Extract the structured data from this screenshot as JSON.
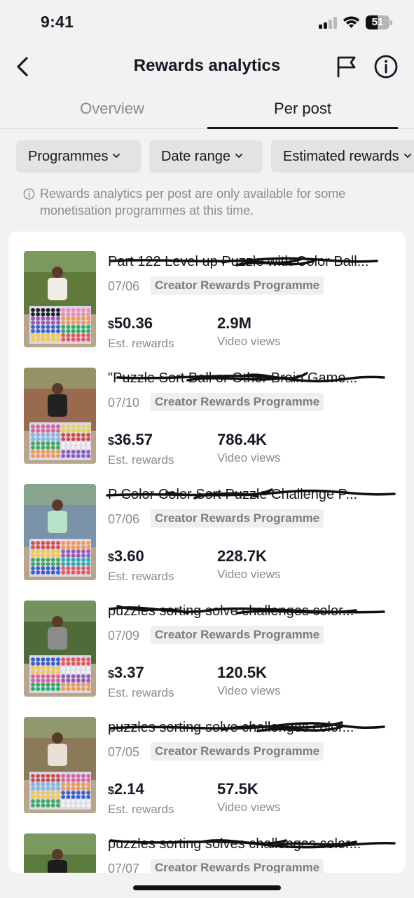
{
  "status_bar": {
    "time": "9:41",
    "battery": "51",
    "battery_level": 0.51
  },
  "header": {
    "title": "Rewards analytics"
  },
  "tabs": [
    {
      "label": "Overview",
      "active": false
    },
    {
      "label": "Per post",
      "active": true
    }
  ],
  "filters": [
    {
      "label": "Programmes"
    },
    {
      "label": "Date range"
    },
    {
      "label": "Estimated rewards"
    }
  ],
  "notice": "Rewards analytics per post are only available for some monetisation programmes at this time.",
  "posts": [
    {
      "title": "Part 122 Level up Puzzle with Color Ball...",
      "date": "07/06",
      "programme": "Creator Rewards Programme",
      "currency": "$",
      "rewards": "50.36",
      "rewards_label": "Est. rewards",
      "views": "2.9M",
      "views_label": "Video views"
    },
    {
      "title": "\"Puzzle Sort Ball or Other Brain Game...",
      "date": "07/10",
      "programme": "Creator Rewards Programme",
      "currency": "$",
      "rewards": "36.57",
      "rewards_label": "Est. rewards",
      "views": "786.4K",
      "views_label": "Video views"
    },
    {
      "title": "P Color Color Sort Puzzle Challenge P...",
      "date": "07/06",
      "programme": "Creator Rewards Programme",
      "currency": "$",
      "rewards": "3.60",
      "rewards_label": "Est. rewards",
      "views": "228.7K",
      "views_label": "Video views"
    },
    {
      "title": "puzzles sorting solve challenges color...",
      "date": "07/09",
      "programme": "Creator Rewards Programme",
      "currency": "$",
      "rewards": "3.37",
      "rewards_label": "Est. rewards",
      "views": "120.5K",
      "views_label": "Video views"
    },
    {
      "title": "puzzles sorting solve challenges color...",
      "date": "07/05",
      "programme": "Creator Rewards Programme",
      "currency": "$",
      "rewards": "2.14",
      "rewards_label": "Est. rewards",
      "views": "57.5K",
      "views_label": "Video views"
    },
    {
      "title": "puzzles sorting solves challenges color...",
      "date": "07/07",
      "programme": "Creator Rewards Programme",
      "currency": "$",
      "rewards": "",
      "rewards_label": "",
      "views": "",
      "views_label": ""
    }
  ]
}
